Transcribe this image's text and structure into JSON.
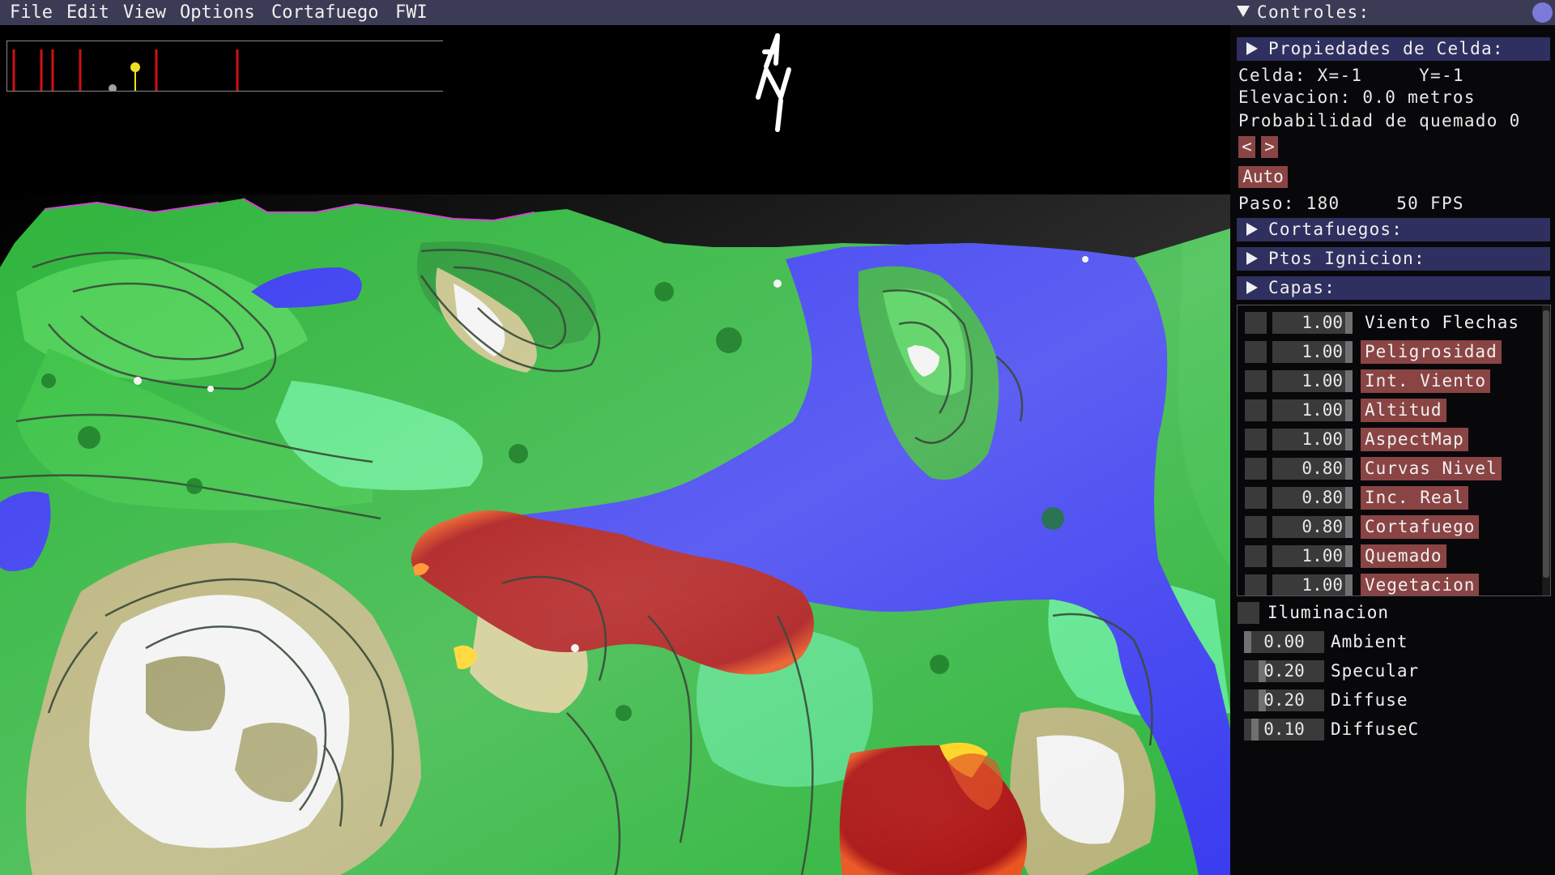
{
  "menubar": {
    "items": [
      "File",
      "Edit",
      "View",
      "Options",
      "Cortafuego",
      "FWI"
    ]
  },
  "panel": {
    "title": "Controles:",
    "cell_section": {
      "header": "Propiedades de Celda:",
      "cell_coords": "Celda: X=-1     Y=-1",
      "elevation": "Elevacion: 0.0 metros",
      "burn_probability": "Probabilidad de quemado 0",
      "prev_label": "<",
      "next_label": ">",
      "auto_label": "Auto",
      "step_fps": "Paso: 180     50 FPS"
    },
    "sections": {
      "firebreaks": "Cortafuegos:",
      "ignition": "Ptos Ignicion:",
      "layers": "Capas:"
    },
    "layers": [
      {
        "value": "1.00",
        "name": "Viento Flechas",
        "highlighted": false,
        "fraction": 1.0
      },
      {
        "value": "1.00",
        "name": "Peligrosidad",
        "highlighted": true,
        "fraction": 1.0
      },
      {
        "value": "1.00",
        "name": "Int. Viento",
        "highlighted": true,
        "fraction": 1.0
      },
      {
        "value": "1.00",
        "name": "Altitud",
        "highlighted": true,
        "fraction": 1.0
      },
      {
        "value": "1.00",
        "name": "AspectMap",
        "highlighted": true,
        "fraction": 1.0
      },
      {
        "value": "0.80",
        "name": "Curvas Nivel",
        "highlighted": true,
        "fraction": 0.8
      },
      {
        "value": "0.80",
        "name": "Inc. Real",
        "highlighted": true,
        "fraction": 0.8
      },
      {
        "value": "0.80",
        "name": "Cortafuego",
        "highlighted": true,
        "fraction": 0.8
      },
      {
        "value": "1.00",
        "name": "Quemado",
        "highlighted": true,
        "fraction": 1.0
      },
      {
        "value": "1.00",
        "name": "Vegetacion",
        "highlighted": true,
        "fraction": 1.0
      }
    ],
    "lighting": {
      "label": "Iluminacion",
      "params": [
        {
          "value": "0.00",
          "name": "Ambient",
          "fraction": 0.0
        },
        {
          "value": "0.20",
          "name": "Specular",
          "fraction": 0.2
        },
        {
          "value": "0.20",
          "name": "Diffuse",
          "fraction": 0.2
        },
        {
          "value": "0.10",
          "name": "DiffuseC",
          "fraction": 0.1
        }
      ]
    }
  },
  "colors": {
    "menubar_bg": "#3b3b55",
    "header_bg": "#2f3060",
    "highlight": "#8a4444",
    "water": "#3a3cf0",
    "vegetation": "#3bc84a",
    "burned": "#b01010"
  }
}
